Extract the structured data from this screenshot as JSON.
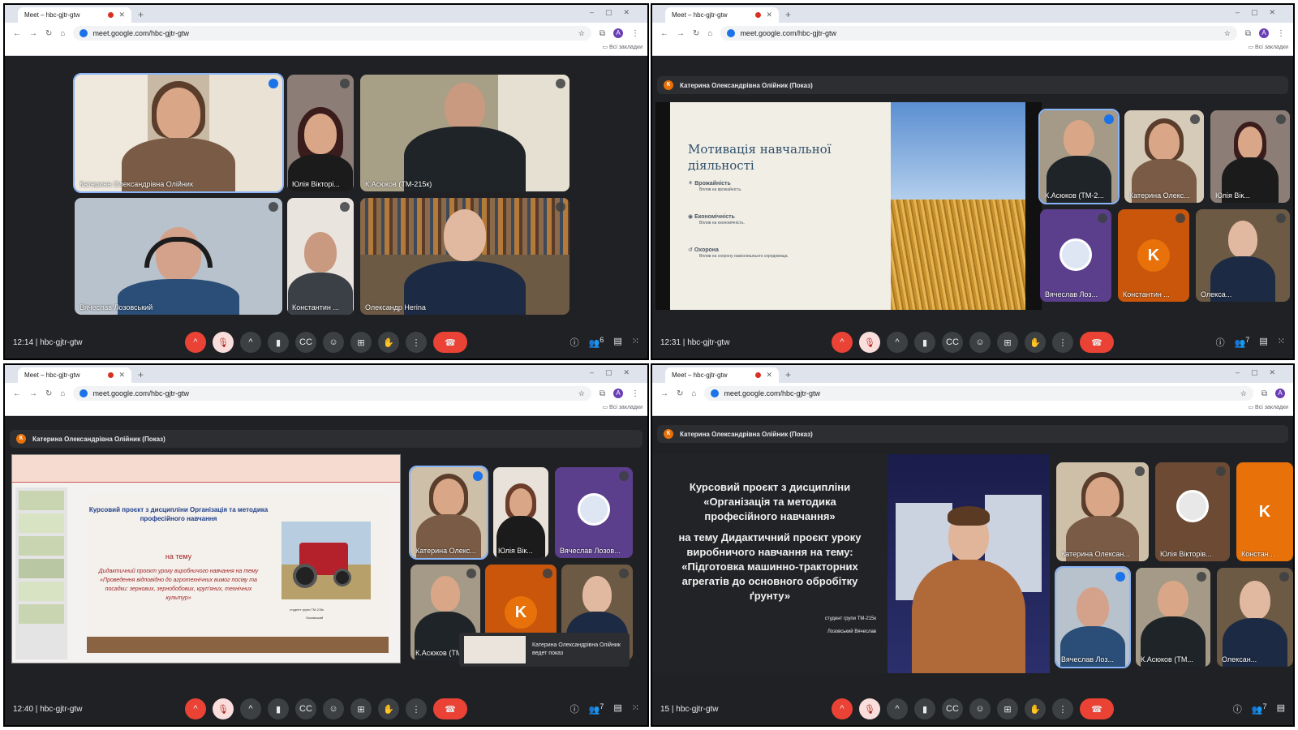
{
  "browser": {
    "tab_title": "Meet – hbc-gjtr-gtw",
    "url": "meet.google.com/hbc-gjtr-gtw",
    "bookmarks": "Всі закладки",
    "avatar": "A"
  },
  "meeting_code": "hbc-gjtr-gtw",
  "q1": {
    "time": "12:14",
    "participants_count": "6",
    "tiles": [
      "Катерина Олександрівна Олійник",
      "Юлія Вікторі...",
      "К.Асюков (ТМ-215к)",
      "Вячеслав Лозовський",
      "Константин ...",
      "Олександр Herina"
    ]
  },
  "q2": {
    "time": "12:31",
    "participants_count": "7",
    "banner": "Катерина Олександрівна Олійник (Показ)",
    "banner_avatar": "К",
    "slide": {
      "title": "Мотивація навчальної діяльності",
      "items": [
        {
          "h": "Врожайність",
          "t": "Вплив на врожайність."
        },
        {
          "h": "Економічність",
          "t": "Вплив на економічність."
        },
        {
          "h": "Охорона",
          "t": "Вплив на охорону навколишнього середовища."
        }
      ]
    },
    "tiles": [
      "К.Асюков (ТМ-2...",
      "Катерина Олекс...",
      "Юлія Вік...",
      "Вячеслав Лоз...",
      "Константин ...",
      "Олекса..."
    ],
    "letter": "K"
  },
  "q3": {
    "time": "12:40",
    "participants_count": "7",
    "banner": "Катерина Олександрівна Олійник (Показ)",
    "banner_avatar": "К",
    "slide": {
      "title": "Курсовий проєкт з дисципліни Організація та методика професійного навчання",
      "subtitle": "на тему",
      "body": "Дидактичний проєкт уроку виробничого навчання на тему «Проведення відповідно до агротехнічних вимог посіву та посадки: зернових, зернобобових, круп'яних, технічних культур»",
      "footer1": "студент групи ТМ-215к",
      "footer2": "Лозовський"
    },
    "tiles": [
      "Катерина Олекс...",
      "Юлія Вік...",
      "Вячеслав Лозов...",
      "К.Асюков (ТМ...",
      "",
      ""
    ],
    "letter": "K",
    "presenting": "Катерина Олександрівна Олійник ведет показ"
  },
  "q4": {
    "time": "15",
    "participants_count": "7",
    "banner": "Катерина Олександрівна Олійник (Показ)",
    "banner_avatar": "К",
    "slide": {
      "line1": "Курсовий проєкт з дисципліни",
      "line2": "«Організація та методика",
      "line3": "професійного навчання»",
      "line4": "на тему Дидактичний проєкт уроку",
      "line5": "виробничого навчання на тему:",
      "line6": "«Підготовка машинно-тракторних",
      "line7": "агрегатів до основного обробітку",
      "line8": "ґрунту»",
      "footer1": "студент групи ТМ-215к",
      "footer2": "Лозовський Вячеслав"
    },
    "tiles": [
      "Катерина Олексан...",
      "Юлія Вікторів...",
      "Констан...",
      "Вячеслав Лоз...",
      "К.Асюков (ТМ...",
      "Олексан..."
    ],
    "letter": "K"
  },
  "colors": {
    "meet_bg": "#202124",
    "end_red": "#ea4335",
    "accent": "#8ab4f8"
  }
}
